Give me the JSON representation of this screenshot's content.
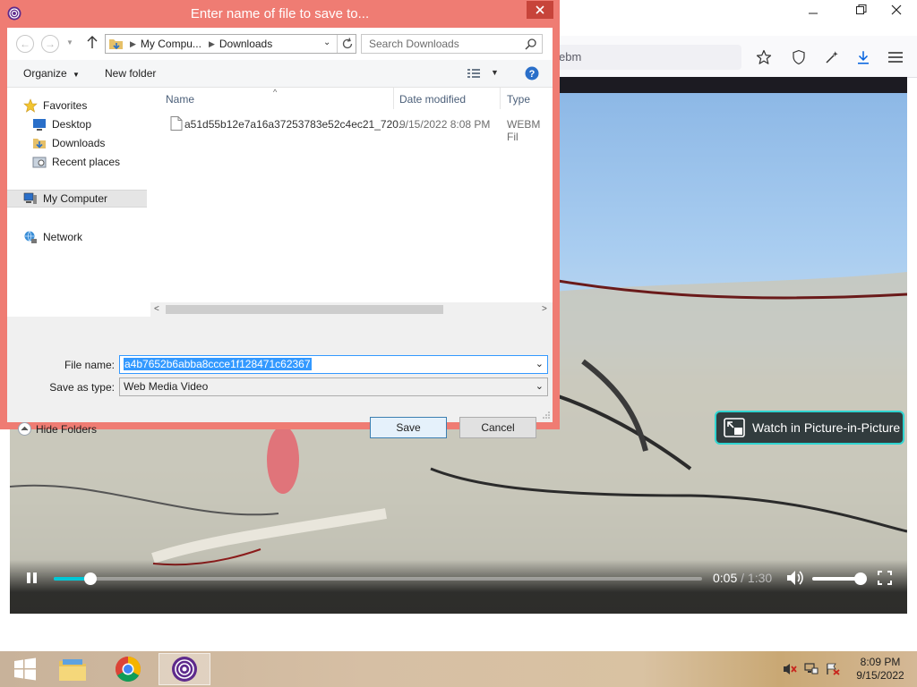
{
  "browser": {
    "url_fragment": "ebm",
    "video": {
      "elapsed": "0:05",
      "separator": "/",
      "duration": "1:30",
      "progress_fraction": 0.056,
      "volume_fraction": 1.0,
      "pip_label": "Watch in Picture-in-Picture"
    }
  },
  "dialog": {
    "title": "Enter name of file to save to...",
    "address": {
      "segments": [
        "My Compu...",
        "Downloads"
      ]
    },
    "search_placeholder": "Search Downloads",
    "toolbar": {
      "organize": "Organize",
      "new_folder": "New folder"
    },
    "nav": {
      "favorites": "Favorites",
      "desktop": "Desktop",
      "downloads": "Downloads",
      "recent": "Recent places",
      "my_computer": "My Computer",
      "network": "Network"
    },
    "columns": {
      "name": "Name",
      "date": "Date modified",
      "type": "Type"
    },
    "files": [
      {
        "name": "a51d55b12e7a16a37253783e52c4ec21_720...",
        "date": "9/15/2022 8:08 PM",
        "type": "WEBM Fil"
      }
    ],
    "form": {
      "filename_label": "File name:",
      "filename_value": "a4b7652b6abba8ccce1f128471c62367",
      "savetype_label": "Save as type:",
      "savetype_value": "Web Media Video"
    },
    "hide_folders": "Hide Folders",
    "save": "Save",
    "cancel": "Cancel"
  },
  "taskbar": {
    "clock_time": "8:09 PM",
    "clock_date": "9/15/2022"
  },
  "colors": {
    "dialog_frame": "#ef7c73",
    "accent": "#00c8d7",
    "pip_border": "#2fd4d0",
    "selection": "#3399ff"
  }
}
